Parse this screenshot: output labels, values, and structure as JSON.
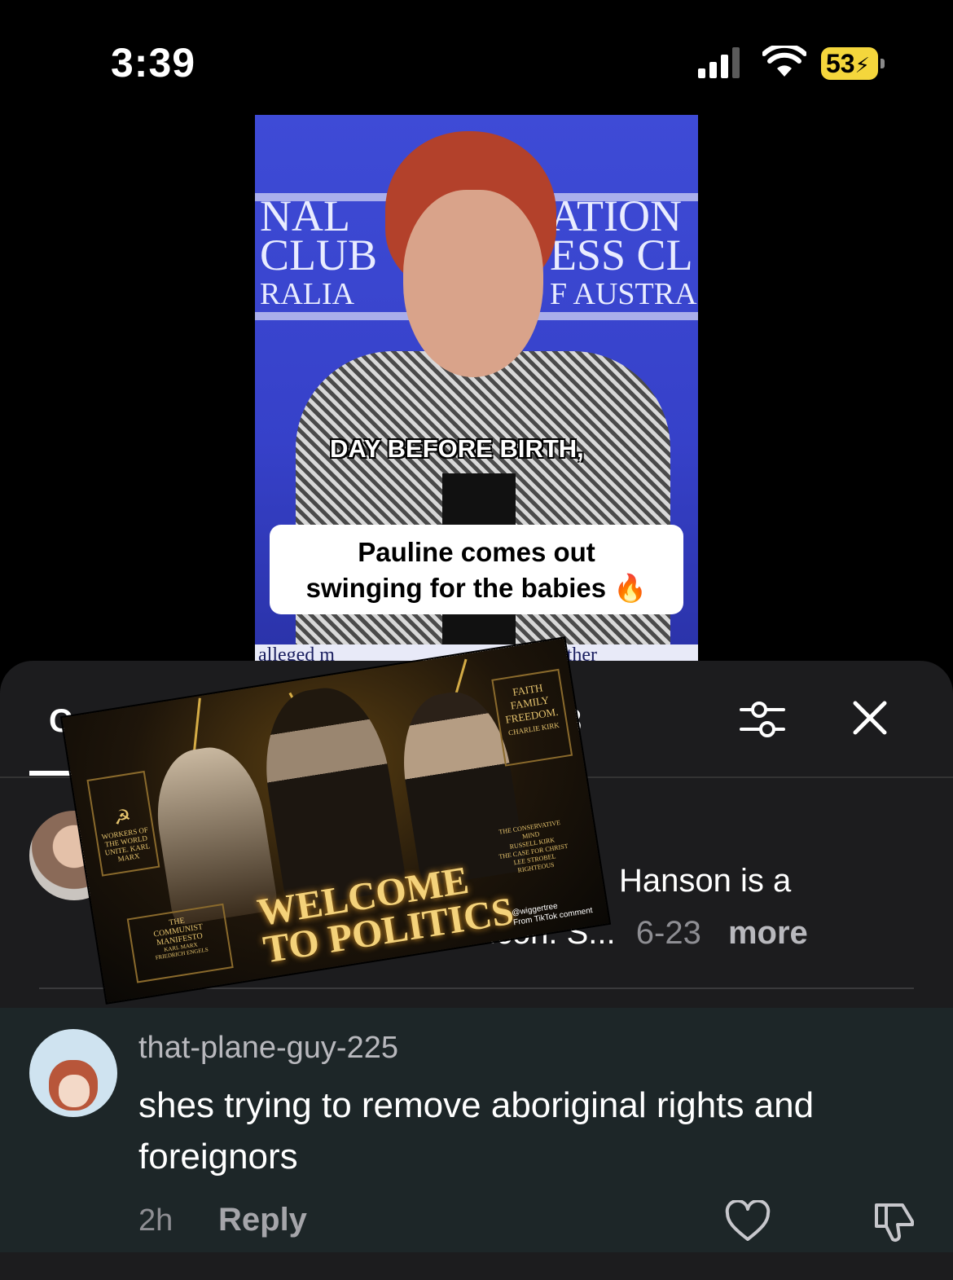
{
  "status_bar": {
    "time": "3:39",
    "battery": "53"
  },
  "video": {
    "backdrop_left": [
      "NAL",
      "CLUB",
      "RALIA"
    ],
    "backdrop_right": [
      "ATION",
      "ESS CL",
      "F AUSTRA"
    ],
    "caption_line": "DAY BEFORE BIRTH,",
    "caption_box_line1": "Pauline comes out",
    "caption_box_line2": "swinging for the babies 🔥",
    "lower_third_left": "alleged m",
    "lower_third_right": "ather"
  },
  "overlay": {
    "headline_line1": "WELCOME",
    "headline_line2": "TO POLITICS",
    "book_left": "WORKERS OF THE WORLD UNITE. KARL MARX",
    "book_right_lines": [
      "FAITH",
      "FAMILY",
      "FREEDOM.",
      "CHARLIE KIRK"
    ],
    "book_bottom_lines": [
      "THE",
      "COMMUNIST",
      "MANIFESTO",
      "KARL MARX",
      "FRIEDRICH ENGELS"
    ],
    "book_stack_lines": [
      "THE CONSERVATIVE MIND",
      "RUSSELL KIRK",
      "THE CASE FOR CHRIST",
      "LEE STROBEL",
      "RIGHTEOUS"
    ],
    "watermark_user": "@wiggertree",
    "watermark_source": "From TikTok comment"
  },
  "comments_panel": {
    "tab_label": "C",
    "tab_count": "3",
    "comments": [
      {
        "visible_text": "Hanson is a",
        "visible_line2": "icon.  S...",
        "date": "6-23",
        "more_label": "more"
      },
      {
        "username": "that-plane-guy-225",
        "text": "shes trying to remove aboriginal rights and foreignors",
        "time": "2h",
        "reply_label": "Reply"
      }
    ]
  },
  "icons": {
    "filter": "sliders-icon",
    "close": "close-icon",
    "like": "heart-icon",
    "dislike": "thumbs-down-icon"
  }
}
